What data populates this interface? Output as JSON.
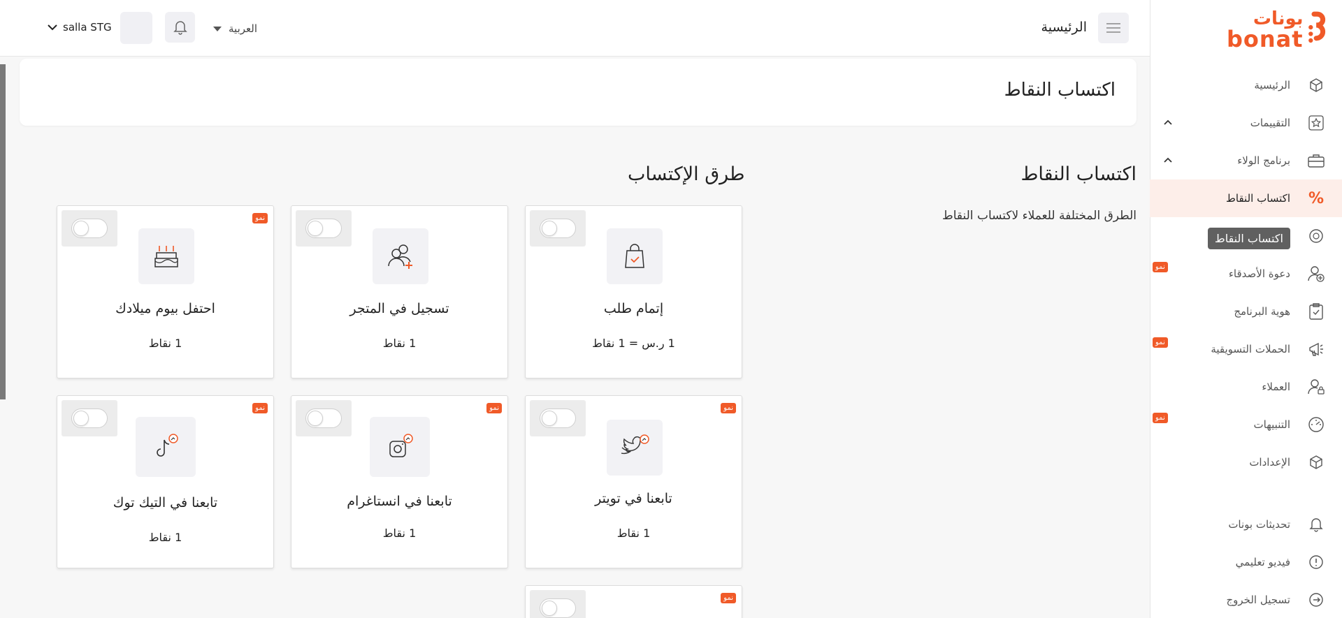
{
  "brand": {
    "name_ar": "بونات",
    "name_en": "bonat",
    "accent": "#f05a28"
  },
  "topbar": {
    "page": "الرئيسية",
    "language": "العربية",
    "store": "salla STG"
  },
  "sidebar": {
    "items": [
      {
        "label": "الرئيسية",
        "icon": "cube-icon"
      },
      {
        "label": "التقييمات",
        "icon": "star-icon",
        "expandable": true
      },
      {
        "label": "برنامج الولاء",
        "icon": "briefcase-icon",
        "expandable": true
      },
      {
        "label": "اكتساب النقاط",
        "icon": "percent-icon",
        "active": true
      },
      {
        "label": "",
        "icon": "coin-icon"
      },
      {
        "label": "دعوة الأصدقاء",
        "icon": "user-plus-icon",
        "badge": "نمو"
      },
      {
        "label": "هوية البرنامج",
        "icon": "clipboard-icon"
      },
      {
        "label": "الحملات التسويقية",
        "icon": "megaphone-icon",
        "badge": "نمو"
      },
      {
        "label": "العملاء",
        "icon": "user-lock-icon"
      },
      {
        "label": "التنبيهات",
        "icon": "gauge-icon",
        "badge": "نمو"
      },
      {
        "label": "الإعدادات",
        "icon": "cube-icon"
      }
    ],
    "tooltip": "اكتساب النقاط",
    "bottom": [
      {
        "label": "تحديثات بونات",
        "icon": "bell-icon"
      },
      {
        "label": "فيديو تعليمي",
        "icon": "alert-circle-icon"
      },
      {
        "label": "تسجيل الخروج",
        "icon": "logout-icon"
      }
    ]
  },
  "content": {
    "header_title": "اكتساب النقاط",
    "section_title": "اكتساب النقاط",
    "section_desc": "الطرق المختلفة للعملاء لاكتساب النقاط",
    "methods_title": "طرق الإكتساب",
    "cards": [
      {
        "title": "إتمام طلب",
        "points": "1 ر.س = 1 نقاط",
        "icon": "shopping-bag-icon",
        "badge": ""
      },
      {
        "title": "تسجيل في المتجر",
        "points": "1 نقاط",
        "icon": "user-add-icon",
        "badge": ""
      },
      {
        "title": "احتفل بيوم ميلادك",
        "points": "1 نقاط",
        "icon": "cake-icon",
        "badge": "نمو"
      },
      {
        "title": "تابعنا في تويتر",
        "points": "1 نقاط",
        "icon": "twitter-icon",
        "badge": "نمو"
      },
      {
        "title": "تابعنا في انستاغرام",
        "points": "1 نقاط",
        "icon": "instagram-icon",
        "badge": "نمو"
      },
      {
        "title": "تابعنا في التيك توك",
        "points": "1 نقاط",
        "icon": "tiktok-icon",
        "badge": "نمو"
      },
      {
        "title": "",
        "points": "",
        "icon": "",
        "badge": "نمو"
      }
    ]
  }
}
